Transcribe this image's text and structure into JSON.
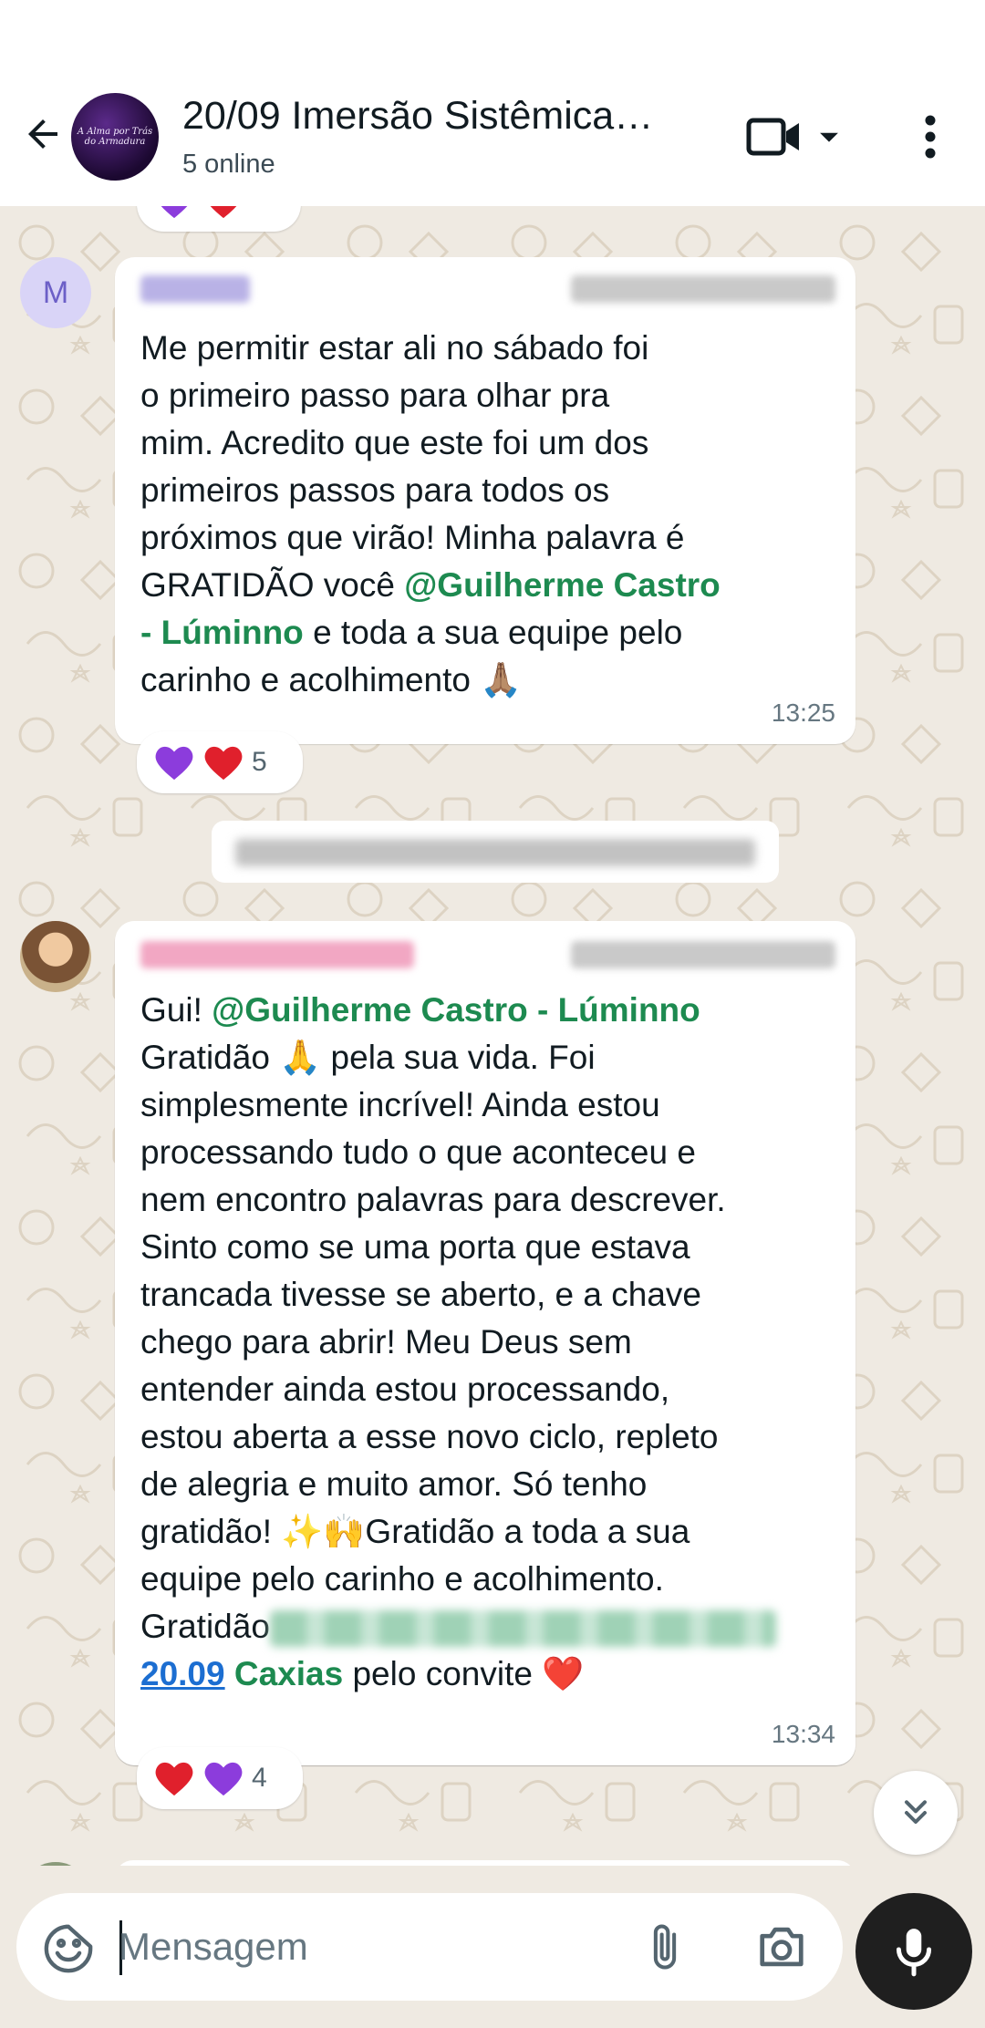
{
  "header": {
    "group_name": "20/09 Imersão Sistêmica…",
    "status": "5 online",
    "avatar_caption": "A Alma por Trás do Armadura",
    "icons": [
      "back-arrow-icon",
      "video-call-icon",
      "chevron-down-icon",
      "more-vert-icon"
    ]
  },
  "chat": {
    "top_partial_reactions": [
      "purple-heart",
      "red-heart"
    ],
    "messages": [
      {
        "avatar_letter": "M",
        "lines": [
          "Me permitir estar ali no sábado foi",
          "o primeiro passo para olhar pra",
          "mim. Acredito que este foi um dos",
          "primeiros passos para todos os",
          "próximos que virão! Minha palavra é"
        ],
        "line6_prefix": "GRATIDÃO  você ",
        "mention_a": "@Guilherme Castro",
        "mention_b": "- Lúminno",
        "line7_suffix": " e toda a sua equipe pelo",
        "line8": "carinho e acolhimento ",
        "line8_emoji": "🙏🏽",
        "time": "13:25",
        "reaction_count": "5",
        "reactions": [
          "purple-heart",
          "red-heart"
        ]
      },
      {
        "line1_prefix": "Gui! ",
        "mention": "@Guilherme Castro - Lúminno",
        "line2_prefix": "Gratidão ",
        "line2_emoji": "🙏",
        "line2_suffix": " pela sua vida. Foi",
        "lines": [
          "simplesmente incrível! Ainda estou",
          "processando tudo o que aconteceu e",
          "nem encontro palavras para descrever.",
          "Sinto como se uma porta que estava",
          "trancada tivesse se aberto, e a chave",
          "chego para abrir! Meu Deus sem",
          "entender ainda estou processando,",
          "estou aberta a esse novo ciclo, repleto",
          "de alegria e muito amor. Só tenho"
        ],
        "line12_prefix": "gratidão! ",
        "line12_emoji": "✨🙌",
        "line12_suffix": "Gratidão a toda a sua",
        "line13": "equipe pelo carinho e acolhimento.",
        "line14_prefix": "Gratidão",
        "link_text": "20.09",
        "link_mention": " Caxias",
        "line15_suffix": " pelo convite ",
        "line15_emoji": "❤️",
        "time": "13:34",
        "reaction_count": "4",
        "reactions": [
          "red-heart",
          "purple-heart"
        ]
      }
    ]
  },
  "input": {
    "placeholder": "Mensagem",
    "icons": [
      "sticker-icon",
      "attach-icon",
      "camera-icon",
      "mic-icon"
    ]
  },
  "colors": {
    "mention": "#1d8a50",
    "link": "#1c6ed1",
    "chat_background": "#efeae2",
    "bubble": "#ffffff",
    "mic_button": "#1f1f1f"
  }
}
